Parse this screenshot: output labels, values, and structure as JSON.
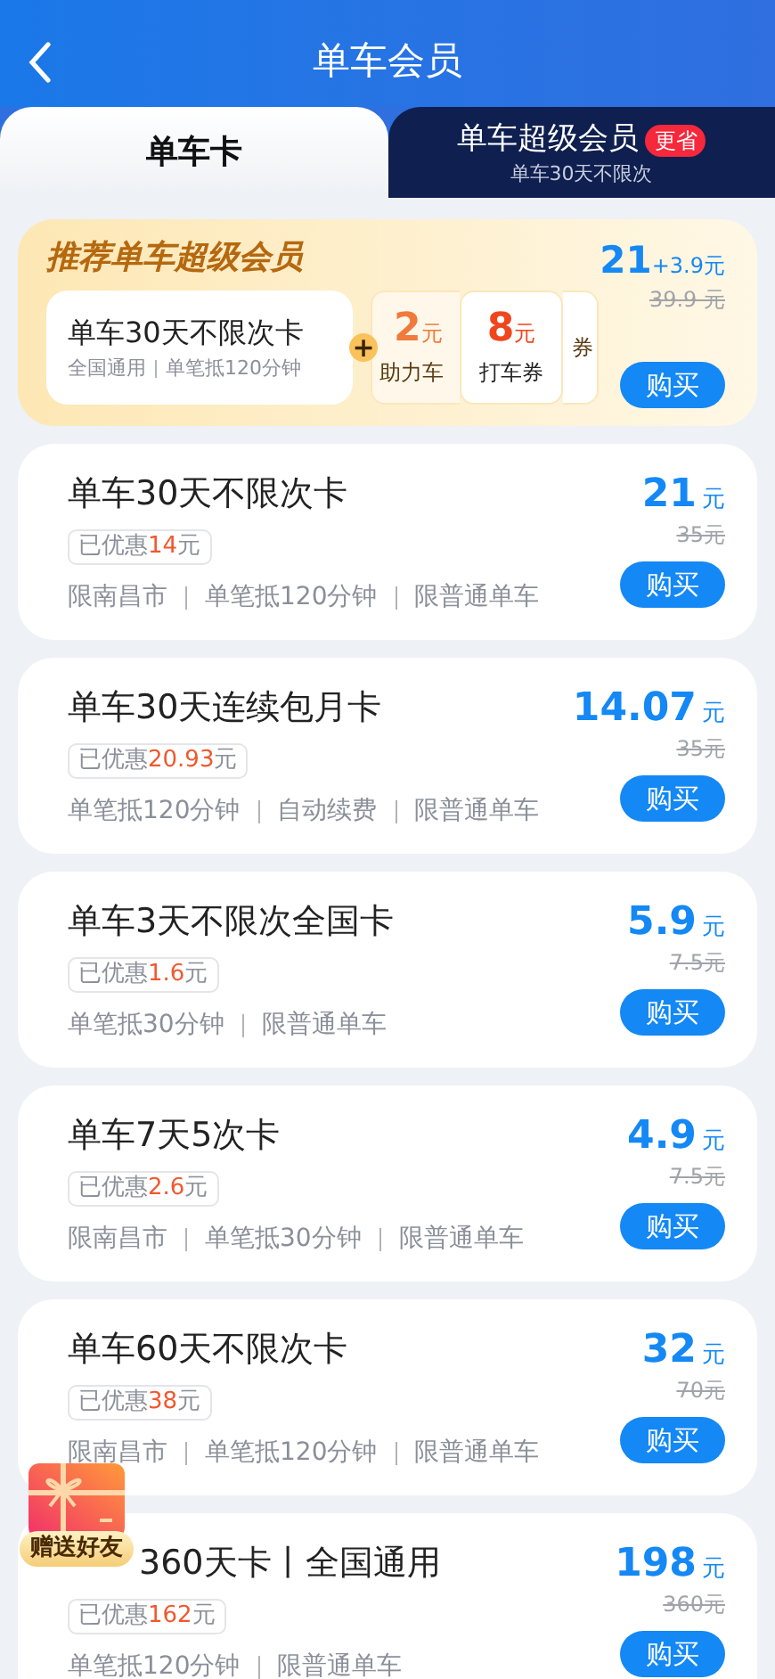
{
  "header": {
    "title": "单车会员"
  },
  "tabs": [
    {
      "label": "单车卡",
      "selected": true
    },
    {
      "label": "单车超级会员",
      "badge": "更省",
      "subtitle": "单车30天不限次",
      "selected": false
    }
  ],
  "promo": {
    "title": "推荐单车超级会员",
    "card_name": "单车30天不限次卡",
    "card_features": [
      "全国通用",
      "单笔抵120分钟"
    ],
    "plus": "+",
    "vouchers": [
      {
        "amount": "2",
        "unit": "元",
        "label": "助力车"
      },
      {
        "amount": "8",
        "unit": "元",
        "label": "打车券"
      },
      {
        "label": "券"
      }
    ],
    "price": "21",
    "price_extra": "+3.9元",
    "original_price": "39.9 元",
    "button": "购买"
  },
  "products": [
    {
      "name": "单车30天不限次卡",
      "discount_label": "已优惠",
      "discount_amount": "14",
      "discount_unit": "元",
      "features": [
        "限南昌市",
        "单笔抵120分钟",
        "限普通单车"
      ],
      "price": "21",
      "unit": "元",
      "original_price": "35元",
      "button": "购买"
    },
    {
      "name": "单车30天连续包月卡",
      "discount_label": "已优惠",
      "discount_amount": "20.93",
      "discount_unit": "元",
      "features": [
        "单笔抵120分钟",
        "自动续费",
        "限普通单车"
      ],
      "price": "14.07",
      "unit": "元",
      "original_price": "35元",
      "button": "购买"
    },
    {
      "name": "单车3天不限次全国卡",
      "discount_label": "已优惠",
      "discount_amount": "1.6",
      "discount_unit": "元",
      "features": [
        "单笔抵30分钟",
        "限普通单车"
      ],
      "price": "5.9",
      "unit": "元",
      "original_price": "7.5元",
      "button": "购买"
    },
    {
      "name": "单车7天5次卡",
      "discount_label": "已优惠",
      "discount_amount": "2.6",
      "discount_unit": "元",
      "features": [
        "限南昌市",
        "单笔抵30分钟",
        "限普通单车"
      ],
      "price": "4.9",
      "unit": "元",
      "original_price": "7.5元",
      "button": "购买"
    },
    {
      "name": "单车60天不限次卡",
      "discount_label": "已优惠",
      "discount_amount": "38",
      "discount_unit": "元",
      "features": [
        "限南昌市",
        "单笔抵120分钟",
        "限普通单车"
      ],
      "price": "32",
      "unit": "元",
      "original_price": "70元",
      "button": "购买"
    },
    {
      "name": "360天卡丨全国通用",
      "discount_label": "已优惠",
      "discount_amount": "162",
      "discount_unit": "元",
      "features": [
        "单笔抵120分钟",
        "限普通单车"
      ],
      "price": "198",
      "unit": "元",
      "original_price": "360元",
      "button": "购买"
    }
  ],
  "gift": {
    "label": "赠送好友"
  }
}
